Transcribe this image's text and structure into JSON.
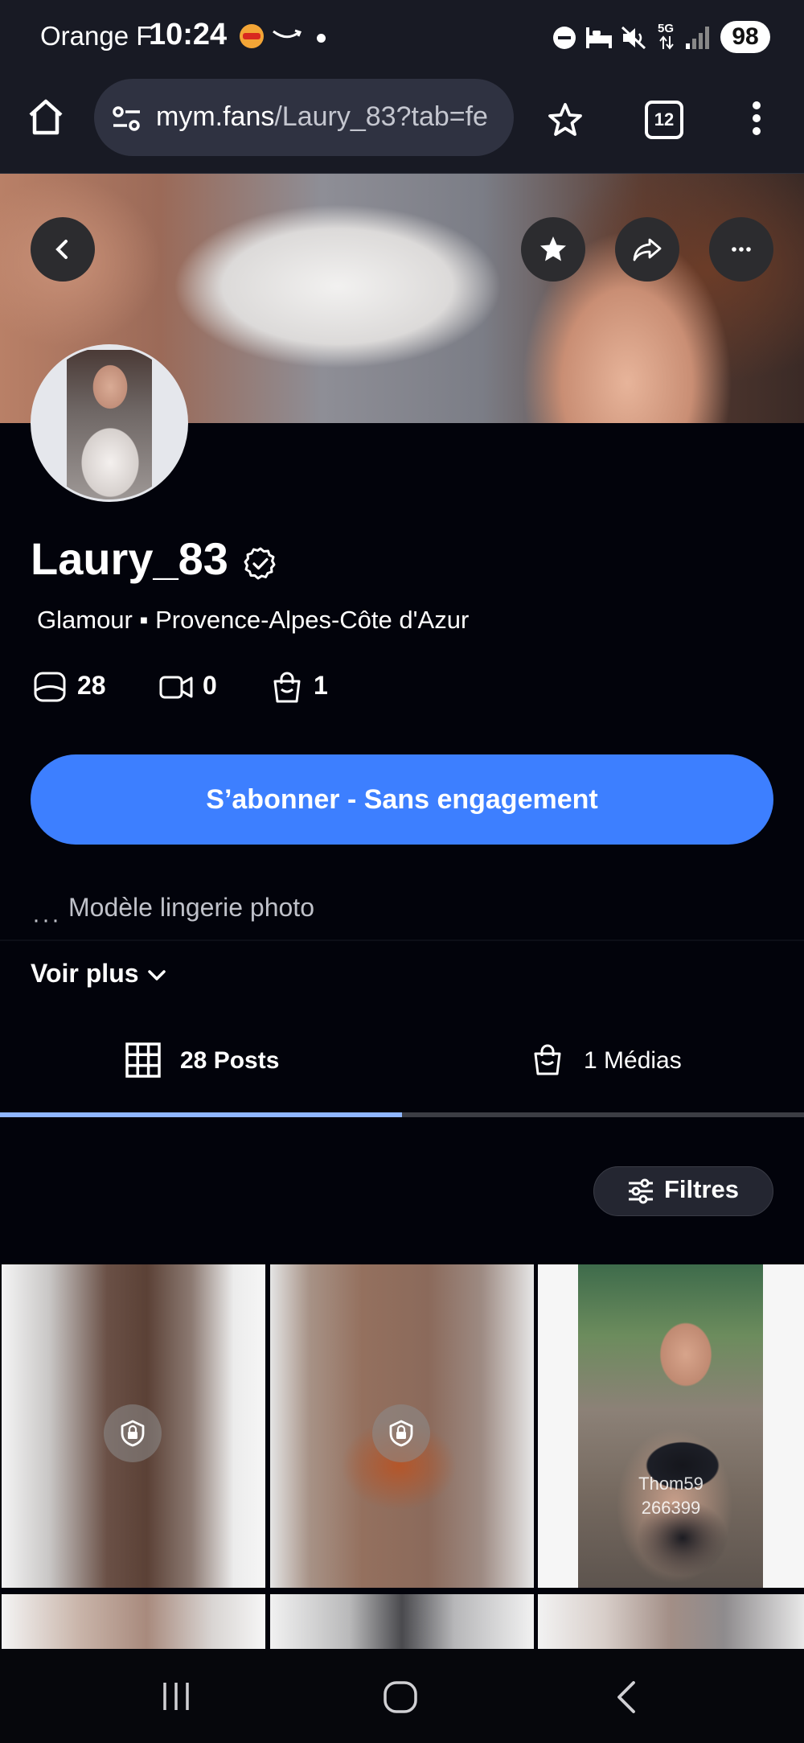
{
  "status_bar": {
    "carrier": "Orange F",
    "time": "10:24",
    "network": "5G",
    "battery": "98"
  },
  "browser": {
    "url_host": "mym.fans",
    "url_path": "/Laury_83?tab=fe",
    "tab_count": "12"
  },
  "profile": {
    "username": "Laury_83",
    "category": "Glamour",
    "separator": "▪",
    "location": "Provence-Alpes-Côte d'Azur",
    "stats": {
      "photos": "28",
      "videos": "0",
      "medias": "1"
    },
    "subscribe_label": "S’abonner - Sans engagement",
    "bio_prefix": "···",
    "bio": "Modèle lingerie photo",
    "see_more": "Voir plus"
  },
  "tabs": [
    {
      "label": "28 Posts",
      "icon": "grid-icon",
      "active": true
    },
    {
      "label": "1 Médias",
      "icon": "bag-icon",
      "active": false
    }
  ],
  "tab_progress": 0.5,
  "filters_label": "Filtres",
  "posts": [
    {
      "locked": true
    },
    {
      "locked": true
    },
    {
      "locked": false,
      "watermark_user": "Thom59",
      "watermark_id": "266399"
    }
  ],
  "colors": {
    "accent": "#3d7fff",
    "background": "#02030b",
    "browser_bar": "#181a24"
  }
}
